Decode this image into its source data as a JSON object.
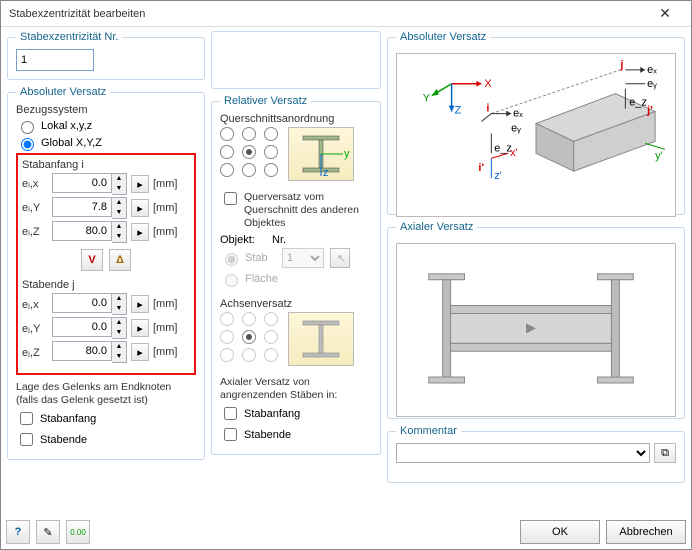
{
  "window": {
    "title": "Stabexzentrizität bearbeiten",
    "close": "✕"
  },
  "nr": {
    "legend": "Stabexzentrizität Nr.",
    "value": "1"
  },
  "abs": {
    "legend": "Absoluter Versatz",
    "bezug": "Bezugssystem",
    "lokal": "Lokal x,y,z",
    "global": "Global X,Y,Z",
    "stabanfang": "Stabanfang i",
    "stabende": "Stabende j",
    "lbl_eix": "eᵢ,x",
    "lbl_eiy": "eᵢ,Y",
    "lbl_eiz": "eᵢ,Z",
    "lbl_ejx": "eⱼ,x",
    "lbl_ejy": "eⱼ,Y",
    "lbl_ejz": "eⱼ,Z",
    "v_eix": "0.0",
    "v_eiy": "7.8",
    "v_eiz": "80.0",
    "v_ejx": "0.0",
    "v_ejy": "0.0",
    "v_ejz": "80.0",
    "unit": "[mm]",
    "lage1": "Lage des Gelenks am Endknoten",
    "lage2": "(falls das Gelenk gesetzt ist)",
    "c_stabanfang": "Stabanfang",
    "c_stabende": "Stabende"
  },
  "rel": {
    "legend": "Relativer Versatz",
    "quer": "Querschnittsanordnung",
    "quer_chk": "Querversatz vom Querschnitt des anderen Objektes",
    "objekt": "Objekt:",
    "nr": "Nr.",
    "stab": "Stab",
    "flaeche": "Fläche",
    "nrval": "1",
    "ach": "Achsenversatz",
    "ax1": "Axialer Versatz von",
    "ax2": "angrenzenden Stäben in:",
    "c_stabanfang": "Stabanfang",
    "c_stabende": "Stabende"
  },
  "col3": {
    "abs_legend": "Absoluter Versatz",
    "ax_legend": "Axialer Versatz",
    "kom_legend": "Kommentar",
    "kom_val": ""
  },
  "bottom": {
    "ok": "OK",
    "cancel": "Abbrechen"
  },
  "icons": {
    "help": "?",
    "edit": "✎",
    "calc": "▥",
    "down": "V",
    "up": "Δ",
    "pick": "↖",
    "copy": "⧉",
    "rarr": "▸"
  }
}
